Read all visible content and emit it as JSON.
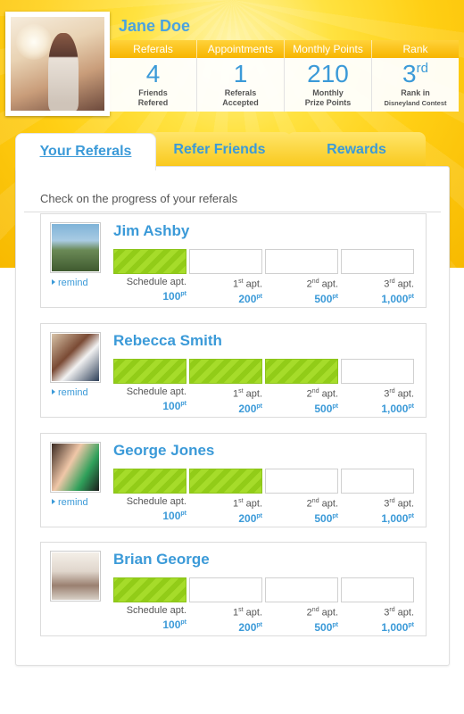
{
  "user": {
    "name": "Jane Doe",
    "avatar_icon": "profile-photo"
  },
  "stats": {
    "headers": [
      "Referals",
      "Appointments",
      "Monthly Points",
      "Rank"
    ],
    "items": [
      {
        "value": "4",
        "label1": "Friends",
        "label2": "Refered"
      },
      {
        "value": "1",
        "label1": "Referals",
        "label2": "Accepted"
      },
      {
        "value": "210",
        "label1": "Monthly",
        "label2": "Prize Points"
      },
      {
        "value": "3",
        "sup": "rd",
        "label1": "Rank in",
        "label2": "Disneyland Contest"
      }
    ]
  },
  "tabs": [
    {
      "label": "Your Referals",
      "active": true
    },
    {
      "label": "Refer Friends",
      "active": false
    },
    {
      "label": "Rewards",
      "active": false
    }
  ],
  "panel": {
    "subtitle": "Check on the progress of your referals"
  },
  "steps": [
    {
      "label": "Schedule apt.",
      "pre": "",
      "sup": "",
      "suffix": "",
      "points": "100",
      "unit": "pt"
    },
    {
      "label": "",
      "pre": "1",
      "sup": "st",
      "suffix": " apt.",
      "points": "200",
      "unit": "pt"
    },
    {
      "label": "",
      "pre": "2",
      "sup": "nd",
      "suffix": " apt.",
      "points": "500",
      "unit": "pt"
    },
    {
      "label": "",
      "pre": "3",
      "sup": "rd",
      "suffix": " apt.",
      "points": "1,000",
      "unit": "pt"
    }
  ],
  "referrals": [
    {
      "name": "Jim Ashby",
      "completed": 1,
      "remind": "remind"
    },
    {
      "name": "Rebecca Smith",
      "completed": 3,
      "remind": "remind"
    },
    {
      "name": "George Jones",
      "completed": 2,
      "remind": "remind"
    },
    {
      "name": "Brian George",
      "completed": 1,
      "remind": ""
    }
  ],
  "colors": {
    "accent": "#3b9ad8",
    "progress": "#a6dc2a",
    "hero": "#ffd01a"
  }
}
